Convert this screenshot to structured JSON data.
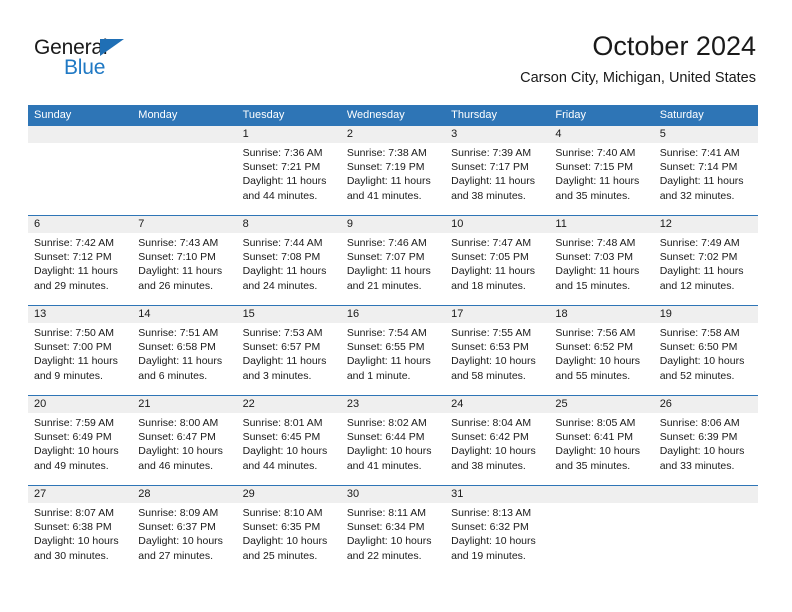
{
  "brand": {
    "name_part1": "General",
    "name_part2": "Blue",
    "triangle_icon": "triangle-icon",
    "accent_color": "#2079c4"
  },
  "header": {
    "title": "October 2024",
    "subtitle": "Carson City, Michigan, United States"
  },
  "colors": {
    "header_blue": "#2e75b6",
    "date_band_gray": "#efefef",
    "text": "#1a1a1a"
  },
  "weekday_headers": [
    "Sunday",
    "Monday",
    "Tuesday",
    "Wednesday",
    "Thursday",
    "Friday",
    "Saturday"
  ],
  "weeks": [
    {
      "dates": [
        "",
        "",
        "1",
        "2",
        "3",
        "4",
        "5"
      ],
      "cells": [
        {
          "sunrise": "",
          "sunset": "",
          "daylight_line1": "",
          "daylight_line2": ""
        },
        {
          "sunrise": "",
          "sunset": "",
          "daylight_line1": "",
          "daylight_line2": ""
        },
        {
          "sunrise": "Sunrise: 7:36 AM",
          "sunset": "Sunset: 7:21 PM",
          "daylight_line1": "Daylight: 11 hours",
          "daylight_line2": "and 44 minutes."
        },
        {
          "sunrise": "Sunrise: 7:38 AM",
          "sunset": "Sunset: 7:19 PM",
          "daylight_line1": "Daylight: 11 hours",
          "daylight_line2": "and 41 minutes."
        },
        {
          "sunrise": "Sunrise: 7:39 AM",
          "sunset": "Sunset: 7:17 PM",
          "daylight_line1": "Daylight: 11 hours",
          "daylight_line2": "and 38 minutes."
        },
        {
          "sunrise": "Sunrise: 7:40 AM",
          "sunset": "Sunset: 7:15 PM",
          "daylight_line1": "Daylight: 11 hours",
          "daylight_line2": "and 35 minutes."
        },
        {
          "sunrise": "Sunrise: 7:41 AM",
          "sunset": "Sunset: 7:14 PM",
          "daylight_line1": "Daylight: 11 hours",
          "daylight_line2": "and 32 minutes."
        }
      ]
    },
    {
      "dates": [
        "6",
        "7",
        "8",
        "9",
        "10",
        "11",
        "12"
      ],
      "cells": [
        {
          "sunrise": "Sunrise: 7:42 AM",
          "sunset": "Sunset: 7:12 PM",
          "daylight_line1": "Daylight: 11 hours",
          "daylight_line2": "and 29 minutes."
        },
        {
          "sunrise": "Sunrise: 7:43 AM",
          "sunset": "Sunset: 7:10 PM",
          "daylight_line1": "Daylight: 11 hours",
          "daylight_line2": "and 26 minutes."
        },
        {
          "sunrise": "Sunrise: 7:44 AM",
          "sunset": "Sunset: 7:08 PM",
          "daylight_line1": "Daylight: 11 hours",
          "daylight_line2": "and 24 minutes."
        },
        {
          "sunrise": "Sunrise: 7:46 AM",
          "sunset": "Sunset: 7:07 PM",
          "daylight_line1": "Daylight: 11 hours",
          "daylight_line2": "and 21 minutes."
        },
        {
          "sunrise": "Sunrise: 7:47 AM",
          "sunset": "Sunset: 7:05 PM",
          "daylight_line1": "Daylight: 11 hours",
          "daylight_line2": "and 18 minutes."
        },
        {
          "sunrise": "Sunrise: 7:48 AM",
          "sunset": "Sunset: 7:03 PM",
          "daylight_line1": "Daylight: 11 hours",
          "daylight_line2": "and 15 minutes."
        },
        {
          "sunrise": "Sunrise: 7:49 AM",
          "sunset": "Sunset: 7:02 PM",
          "daylight_line1": "Daylight: 11 hours",
          "daylight_line2": "and 12 minutes."
        }
      ]
    },
    {
      "dates": [
        "13",
        "14",
        "15",
        "16",
        "17",
        "18",
        "19"
      ],
      "cells": [
        {
          "sunrise": "Sunrise: 7:50 AM",
          "sunset": "Sunset: 7:00 PM",
          "daylight_line1": "Daylight: 11 hours",
          "daylight_line2": "and 9 minutes."
        },
        {
          "sunrise": "Sunrise: 7:51 AM",
          "sunset": "Sunset: 6:58 PM",
          "daylight_line1": "Daylight: 11 hours",
          "daylight_line2": "and 6 minutes."
        },
        {
          "sunrise": "Sunrise: 7:53 AM",
          "sunset": "Sunset: 6:57 PM",
          "daylight_line1": "Daylight: 11 hours",
          "daylight_line2": "and 3 minutes."
        },
        {
          "sunrise": "Sunrise: 7:54 AM",
          "sunset": "Sunset: 6:55 PM",
          "daylight_line1": "Daylight: 11 hours",
          "daylight_line2": "and 1 minute."
        },
        {
          "sunrise": "Sunrise: 7:55 AM",
          "sunset": "Sunset: 6:53 PM",
          "daylight_line1": "Daylight: 10 hours",
          "daylight_line2": "and 58 minutes."
        },
        {
          "sunrise": "Sunrise: 7:56 AM",
          "sunset": "Sunset: 6:52 PM",
          "daylight_line1": "Daylight: 10 hours",
          "daylight_line2": "and 55 minutes."
        },
        {
          "sunrise": "Sunrise: 7:58 AM",
          "sunset": "Sunset: 6:50 PM",
          "daylight_line1": "Daylight: 10 hours",
          "daylight_line2": "and 52 minutes."
        }
      ]
    },
    {
      "dates": [
        "20",
        "21",
        "22",
        "23",
        "24",
        "25",
        "26"
      ],
      "cells": [
        {
          "sunrise": "Sunrise: 7:59 AM",
          "sunset": "Sunset: 6:49 PM",
          "daylight_line1": "Daylight: 10 hours",
          "daylight_line2": "and 49 minutes."
        },
        {
          "sunrise": "Sunrise: 8:00 AM",
          "sunset": "Sunset: 6:47 PM",
          "daylight_line1": "Daylight: 10 hours",
          "daylight_line2": "and 46 minutes."
        },
        {
          "sunrise": "Sunrise: 8:01 AM",
          "sunset": "Sunset: 6:45 PM",
          "daylight_line1": "Daylight: 10 hours",
          "daylight_line2": "and 44 minutes."
        },
        {
          "sunrise": "Sunrise: 8:02 AM",
          "sunset": "Sunset: 6:44 PM",
          "daylight_line1": "Daylight: 10 hours",
          "daylight_line2": "and 41 minutes."
        },
        {
          "sunrise": "Sunrise: 8:04 AM",
          "sunset": "Sunset: 6:42 PM",
          "daylight_line1": "Daylight: 10 hours",
          "daylight_line2": "and 38 minutes."
        },
        {
          "sunrise": "Sunrise: 8:05 AM",
          "sunset": "Sunset: 6:41 PM",
          "daylight_line1": "Daylight: 10 hours",
          "daylight_line2": "and 35 minutes."
        },
        {
          "sunrise": "Sunrise: 8:06 AM",
          "sunset": "Sunset: 6:39 PM",
          "daylight_line1": "Daylight: 10 hours",
          "daylight_line2": "and 33 minutes."
        }
      ]
    },
    {
      "dates": [
        "27",
        "28",
        "29",
        "30",
        "31",
        "",
        ""
      ],
      "cells": [
        {
          "sunrise": "Sunrise: 8:07 AM",
          "sunset": "Sunset: 6:38 PM",
          "daylight_line1": "Daylight: 10 hours",
          "daylight_line2": "and 30 minutes."
        },
        {
          "sunrise": "Sunrise: 8:09 AM",
          "sunset": "Sunset: 6:37 PM",
          "daylight_line1": "Daylight: 10 hours",
          "daylight_line2": "and 27 minutes."
        },
        {
          "sunrise": "Sunrise: 8:10 AM",
          "sunset": "Sunset: 6:35 PM",
          "daylight_line1": "Daylight: 10 hours",
          "daylight_line2": "and 25 minutes."
        },
        {
          "sunrise": "Sunrise: 8:11 AM",
          "sunset": "Sunset: 6:34 PM",
          "daylight_line1": "Daylight: 10 hours",
          "daylight_line2": "and 22 minutes."
        },
        {
          "sunrise": "Sunrise: 8:13 AM",
          "sunset": "Sunset: 6:32 PM",
          "daylight_line1": "Daylight: 10 hours",
          "daylight_line2": "and 19 minutes."
        },
        {
          "sunrise": "",
          "sunset": "",
          "daylight_line1": "",
          "daylight_line2": ""
        },
        {
          "sunrise": "",
          "sunset": "",
          "daylight_line1": "",
          "daylight_line2": ""
        }
      ]
    }
  ]
}
